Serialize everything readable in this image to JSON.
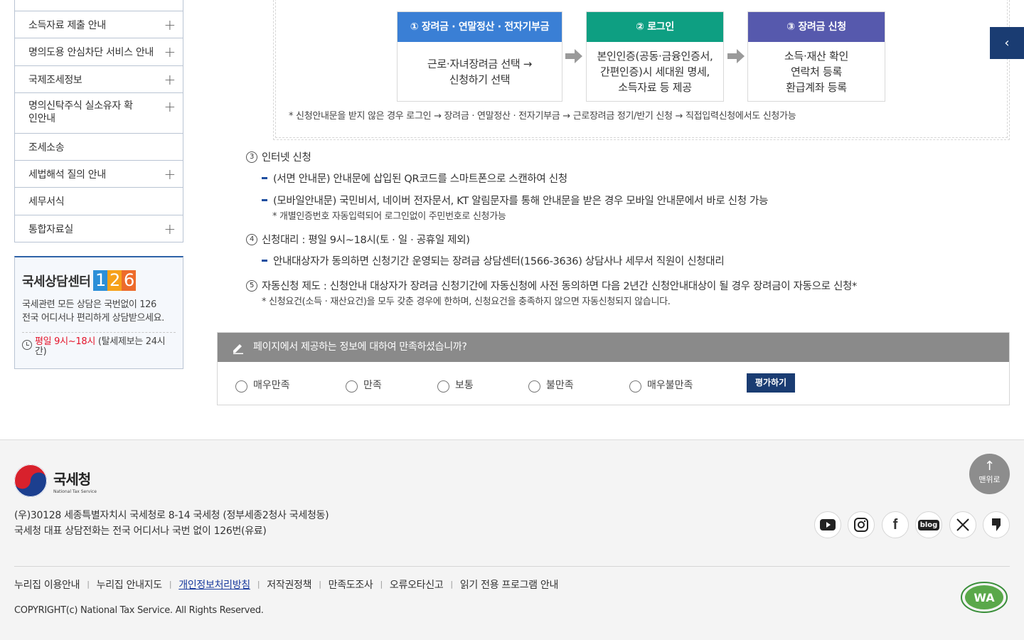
{
  "sidebar": {
    "items": [
      {
        "label": "소득자료 제출 안내",
        "expandable": true
      },
      {
        "label": "명의도용 안심차단 서비스 안내",
        "expandable": true
      },
      {
        "label": "국제조세정보",
        "expandable": true
      },
      {
        "label": "명의신탁주식 실소유자 확인안내",
        "expandable": true
      },
      {
        "label": "조세소송",
        "expandable": false
      },
      {
        "label": "세법해석 질의 안내",
        "expandable": true
      },
      {
        "label": "세무서식",
        "expandable": false
      },
      {
        "label": "통합자료실",
        "expandable": true
      }
    ],
    "plus_symbol": "+"
  },
  "consult": {
    "title": "국세상담센터",
    "number_digits": [
      "1",
      "2",
      "6"
    ],
    "desc_line1": "국세관련 모든 상담은 국번없이 126",
    "desc_line2": "전국 어디서나 편리하게 상담받으세요.",
    "time_red": "평일 9시~18시",
    "time_rest": " (탈세제보는 24시간)"
  },
  "procedure": {
    "steps": [
      {
        "head": "① 장려금 · 연말정산 · 전자기부금",
        "body1": "근로·자녀장려금 선택 →",
        "body2": "신청하기 선택",
        "body3": ""
      },
      {
        "head": "② 로그인",
        "body1": "본인인증(공동·금융인증서,",
        "body2": "간편인증)시 세대원 명세,",
        "body3": "소득자료 등 제공"
      },
      {
        "head": "③ 장려금 신청",
        "body1": "소득·재산 확인",
        "body2": "연락처 등록",
        "body3": "환급계좌 등록"
      }
    ],
    "note": "* 신청안내문을 받지 않은 경우 로그인 → 장려금 · 연말정산 · 전자기부금 → 근로장려금 정기/반기 신청 → 직접입력신청에서도 신청가능"
  },
  "content": {
    "item3": {
      "num": "3",
      "title": "인터넷 신청"
    },
    "item3_sub1": "(서면 안내문) 안내문에 삽입된 QR코드를 스마트폰으로 스캔하여 신청",
    "item3_sub2": "(모바일안내문) 국민비서, 네이버 전자문서, KT 알림문자를 통해 안내문을 받은 경우 모바일 안내문에서 바로 신청 가능",
    "item3_note": "* 개별인증번호 자동입력되어 로그인없이 주민번호로 신청가능",
    "item4": {
      "num": "4",
      "title": "신청대리 : 평일 9시~18시(토 · 일 · 공휴일 제외)"
    },
    "item4_sub1": "안내대상자가 동의하면 신청기간 운영되는 장려금 상담센터(1566-3636) 상담사나 세무서 직원이 신청대리",
    "item5": {
      "num": "5",
      "title": "자동신청 제도 : 신청안내 대상자가 장려금 신청기간에 자동신청에 사전 동의하면 다음 2년간 신청안내대상이 될 경우 장려금이 자동으로 신청*"
    },
    "item5_note": "* 신청요건(소득 · 재산요건)을 모두 갖춘 경우에 한하며, 신청요건을 충족하지 않으면 자동신청되지 않습니다."
  },
  "survey": {
    "question": "페이지에서 제공하는 정보에 대하여 만족하셨습니까?",
    "options": [
      "매우만족",
      "만족",
      "보통",
      "불만족",
      "매우불만족"
    ],
    "submit": "평가하기"
  },
  "side_toggle": "‹",
  "footer": {
    "logo_ko": "국세청",
    "logo_en": "National Tax Service",
    "address": "(우)30128 세종특별자치시 국세청로 8-14 국세청 (정부세종2청사 국세청동)",
    "phone": "국세청 대표 상담전화는 전국 어디서나 국번 없이 126번(유료)",
    "top_label": "맨위로",
    "top_arrow": "↑",
    "sns": [
      {
        "icon": "youtube-icon",
        "glyph": "▶"
      },
      {
        "icon": "instagram-icon",
        "glyph": "◎"
      },
      {
        "icon": "facebook-icon",
        "glyph": "f"
      },
      {
        "icon": "blog-icon",
        "glyph": "blog"
      },
      {
        "icon": "x-icon",
        "glyph": "X"
      },
      {
        "icon": "post-icon",
        "glyph": "❜"
      }
    ],
    "links": [
      "누리집 이용안내",
      "누리집 안내지도",
      "개인정보처리방침",
      "저작권정책",
      "만족도조사",
      "오류오타신고",
      "읽기 전용 프로그램 안내"
    ],
    "copyright": "COPYRIGHT(c) National Tax Service. All Rights Reserved.",
    "wa_mark": "WA"
  },
  "colors": {
    "step1": "#3a7fd5",
    "step2": "#0e9f82",
    "step3": "#5659ad",
    "navy": "#1a3c72",
    "red": "#e4142a"
  }
}
